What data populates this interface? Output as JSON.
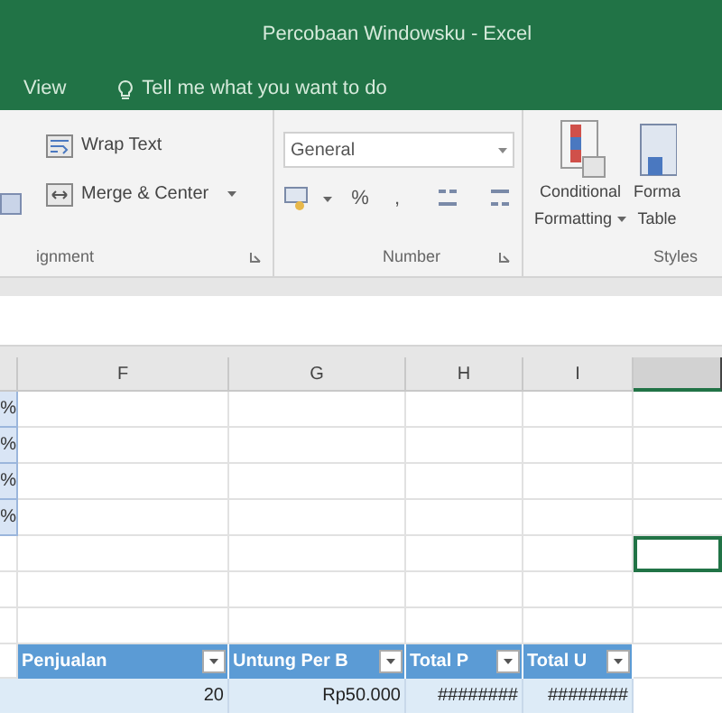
{
  "window": {
    "title": "Percobaan Windowsku  -  Excel"
  },
  "tabs": [
    {
      "label": "View",
      "selected": false
    }
  ],
  "tell_me": "Tell me what you want to do",
  "ribbon": {
    "alignment": {
      "buttons": [
        "Wrap Text",
        "Merge & Center"
      ],
      "label": "ignment"
    },
    "number": {
      "format": "General",
      "symbols": [
        "%",
        ","
      ],
      "label": "Number"
    },
    "styles": {
      "buttons": [
        {
          "lines": [
            "Conditional",
            "Formatting"
          ],
          "dropdown": true
        },
        {
          "lines": [
            "Forma",
            "Table"
          ],
          "dropdown": false
        }
      ],
      "label": "Styles"
    }
  },
  "sheet": {
    "columns": [
      {
        "label": "F",
        "selected": false
      },
      {
        "label": "G",
        "selected": false
      },
      {
        "label": "H",
        "selected": false
      },
      {
        "label": "I",
        "selected": false
      },
      {
        "selected": true
      }
    ],
    "rows": [
      {
        "edge": "%",
        "selected": false
      },
      {
        "edge": "%",
        "selected": false
      },
      {
        "edge": "%",
        "selected": false
      },
      {
        "edge": "%",
        "selected": false
      },
      {
        "selected": true
      },
      {
        "selected": false
      },
      {
        "selected": false
      }
    ],
    "table": {
      "headers": [
        "Penjualan",
        "Untung Per B",
        "Total P",
        "Total U"
      ],
      "row": [
        "20",
        "Rp50.000",
        "########",
        "########"
      ]
    }
  }
}
